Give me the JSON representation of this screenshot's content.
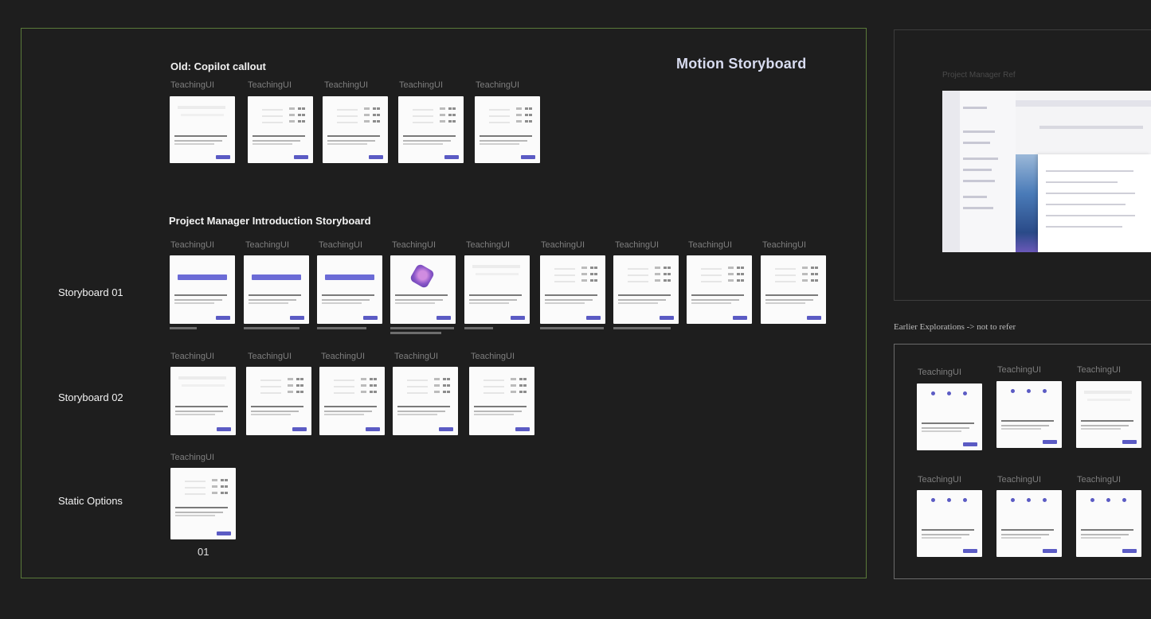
{
  "main": {
    "title": "Motion Storyboard",
    "sections": {
      "copilot": {
        "title": "Old: Copilot callout"
      },
      "intro": {
        "title": "Project Manager Introduction Storyboard"
      }
    },
    "rows": {
      "storyboard1": "Storyboard 01",
      "storyboard2": "Storyboard 02",
      "static": "Static Options"
    },
    "static_caption": "01",
    "card_label": "TeachingUI"
  },
  "prototype": {
    "label": "Project Manager Ref"
  },
  "explorations": {
    "title": "Earlier Explorations -> not to refer",
    "card_label": "TeachingUI"
  },
  "colors": {
    "background": "#1e1e1e",
    "main_frame_border": "#5a7a3a",
    "accent_button": "#5b5bc4"
  }
}
